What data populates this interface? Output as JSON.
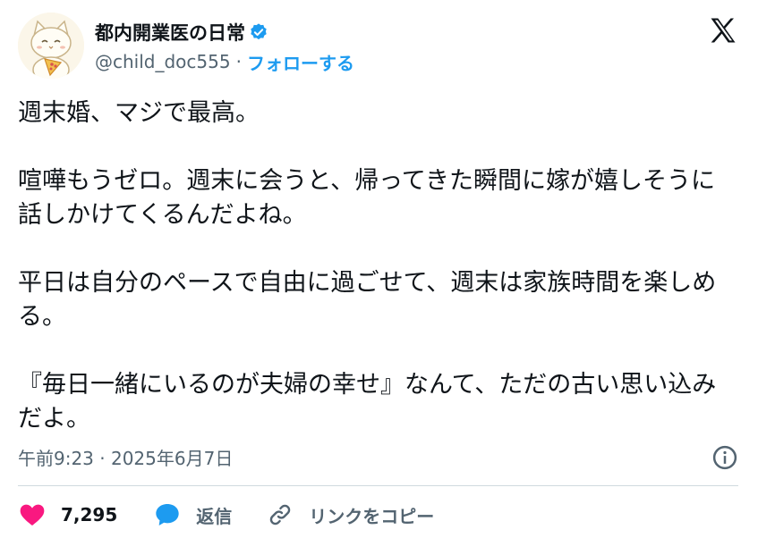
{
  "author": {
    "display_name": "都内開業医の日常",
    "handle": "@child_doc555",
    "separator": "·",
    "follow_label": "フォローする",
    "verified": true
  },
  "tweet": {
    "paragraphs": [
      "週末婚、マジで最高。",
      "喧嘩もうゼロ。週末に会うと、帰ってきた瞬間に嫁が嬉しそうに話しかけてくるんだよね。",
      "平日は自分のペースで自由に過ごせて、週末は家族時間を楽しめる。",
      "『毎日一緒にいるのが夫婦の幸せ』なんて、ただの古い思い込みだよ。"
    ]
  },
  "meta": {
    "timestamp": "午前9:23 · 2025年6月7日"
  },
  "actions": {
    "like_count": "7,295",
    "reply_label": "返信",
    "copy_link_label": "リンクをコピー"
  },
  "icons": {
    "verified": "verified-badge-icon",
    "x_logo": "x-logo-icon",
    "info": "info-icon",
    "like": "heart-icon",
    "reply": "speech-bubble-icon",
    "copy": "link-icon"
  },
  "colors": {
    "accent": "#1d9bf0",
    "like": "#f91880",
    "text": "#0f1419",
    "secondary": "#536471",
    "divider": "#cfd9de"
  }
}
